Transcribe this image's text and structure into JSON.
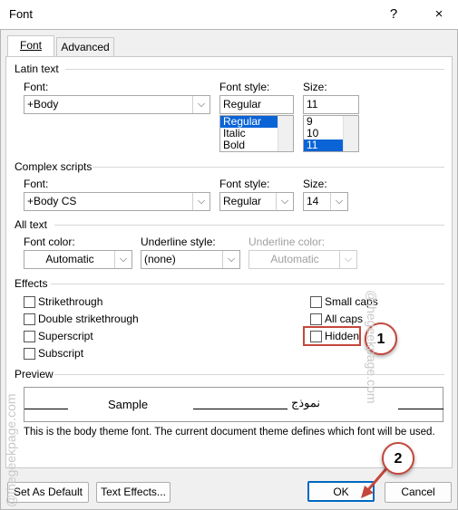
{
  "window": {
    "title": "Font",
    "help": "?",
    "close": "×"
  },
  "tabs": [
    {
      "label": "Font"
    },
    {
      "label": "Advanced"
    }
  ],
  "latin": {
    "section": "Latin text",
    "font_label": "Font:",
    "font_value": "+Body",
    "style_label": "Font style:",
    "style_value": "Regular",
    "style_list": [
      "Regular",
      "Italic",
      "Bold"
    ],
    "size_label": "Size:",
    "size_value": "11",
    "size_list": [
      "9",
      "10",
      "11"
    ]
  },
  "complex": {
    "section": "Complex scripts",
    "font_label": "Font:",
    "font_value": "+Body CS",
    "style_label": "Font style:",
    "style_value": "Regular",
    "size_label": "Size:",
    "size_value": "14"
  },
  "alltext": {
    "section": "All text",
    "color_label": "Font color:",
    "color_value": "Automatic",
    "underline_label": "Underline style:",
    "underline_value": "(none)",
    "ucolor_label": "Underline color:",
    "ucolor_value": "Automatic"
  },
  "effects": {
    "section": "Effects",
    "left": [
      "Strikethrough",
      "Double strikethrough",
      "Superscript",
      "Subscript"
    ],
    "right": [
      "Small caps",
      "All caps",
      "Hidden"
    ]
  },
  "preview": {
    "section": "Preview",
    "sample": "Sample",
    "sample_rtl": "نموذج",
    "description": "This is the body theme font. The current document theme defines which font will be used."
  },
  "buttons": {
    "default": "Set As Default",
    "effects": "Text Effects...",
    "ok": "OK",
    "cancel": "Cancel"
  },
  "callouts": {
    "one": "1",
    "two": "2"
  },
  "watermark": "@thegeekpage.com",
  "colors": {
    "accent": "#0067c0",
    "highlight": "#c4473c",
    "selection": "#0a64d6"
  }
}
